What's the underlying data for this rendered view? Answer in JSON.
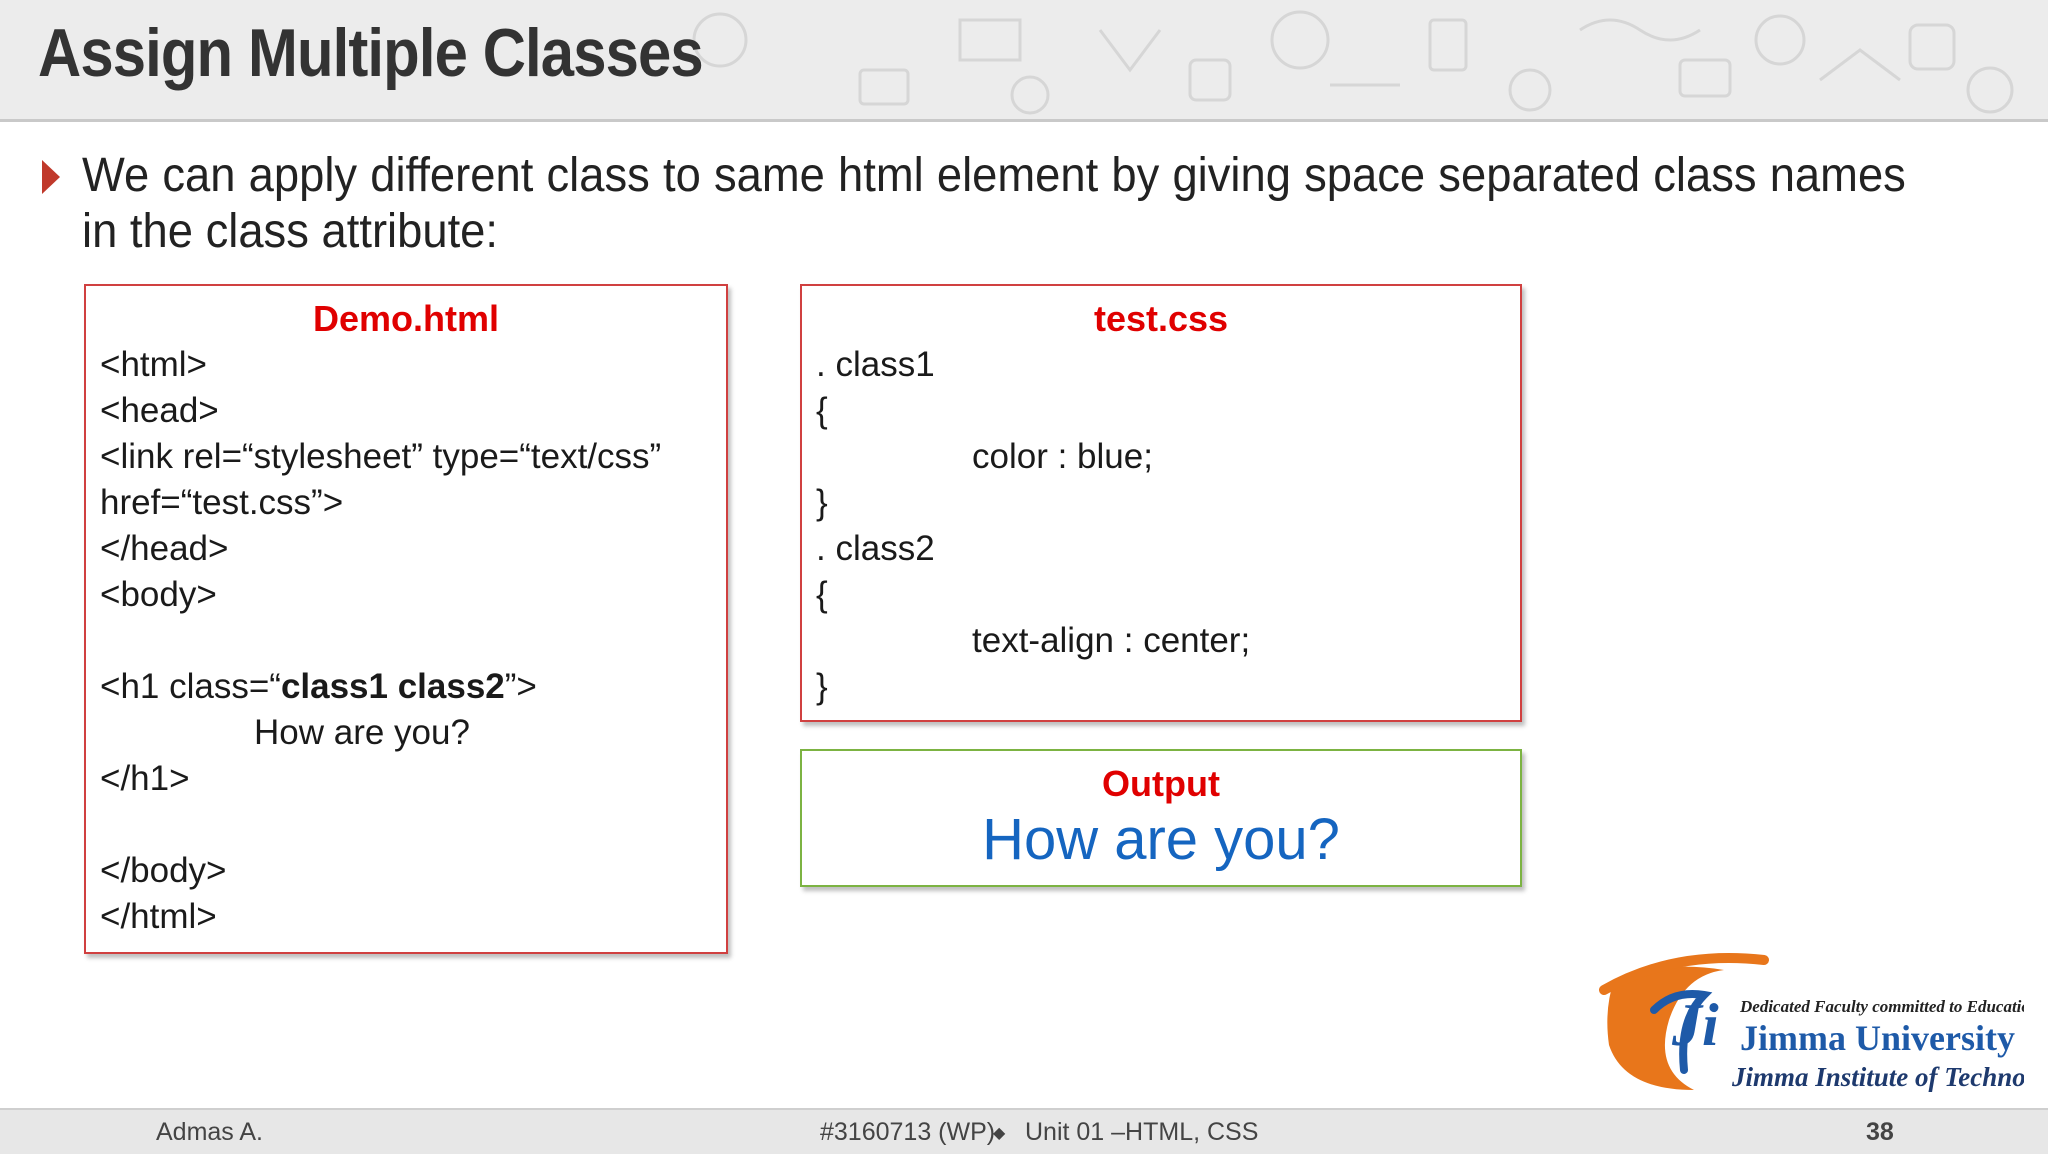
{
  "slide": {
    "title": "Assign Multiple Classes",
    "bullet": "We can apply different class to same html element by giving space separated class names in the class attribute:"
  },
  "demo_box": {
    "title": "Demo.html",
    "lines": [
      "<html>",
      "<head>",
      "<link rel=“stylesheet” type=“text/css”",
      "href=“test.css”>",
      "</head>",
      "<body>",
      "<h1 class=“",
      "class1 class2",
      "”>",
      "How are you?",
      "</h1>",
      "</body>",
      "</html>"
    ]
  },
  "css_box": {
    "title": "test.css",
    "lines": [
      ". class1",
      "{",
      "color : blue;",
      "}",
      ". class2",
      "{",
      "text-align : center;",
      "}"
    ]
  },
  "output_box": {
    "title": "Output",
    "text": "How are you?",
    "text_color": "#1565c0"
  },
  "logo": {
    "tagline": "Dedicated Faculty committed to Education",
    "name": "Jimma University",
    "subtitle": "Jimma Institute of Technology"
  },
  "footer": {
    "author": "Admas A.",
    "course": "#3160713 (WP)",
    "unit": "Unit 01 –HTML, CSS",
    "page": "38"
  },
  "colors": {
    "accent_red": "#e00000",
    "bullet": "#c0392b",
    "output_border": "#7cb342"
  }
}
